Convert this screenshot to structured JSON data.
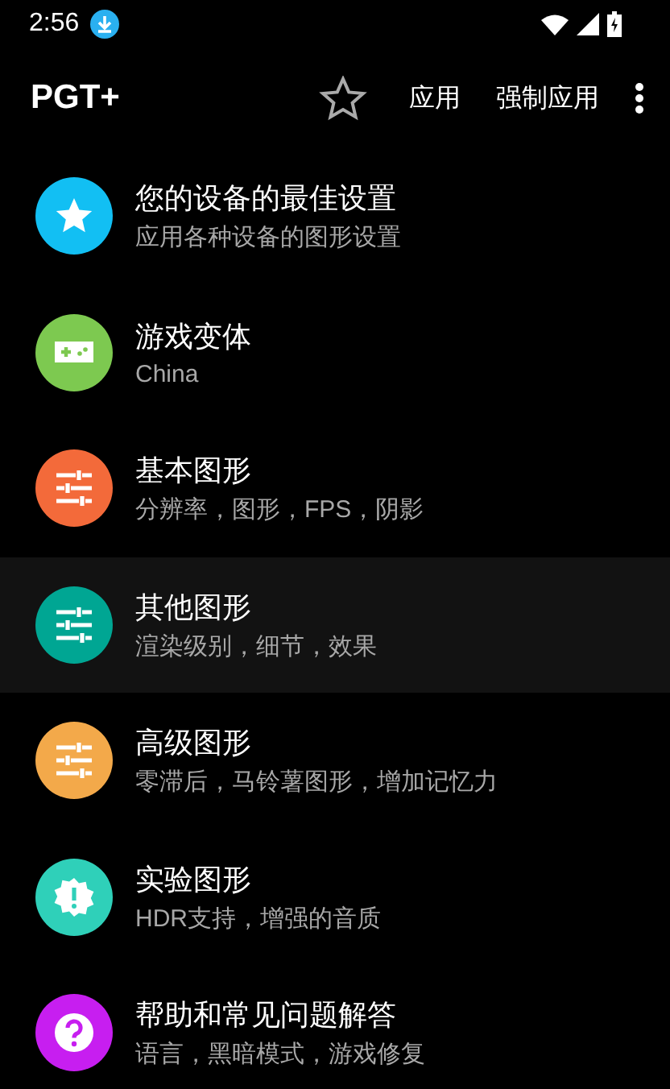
{
  "status_bar": {
    "time": "2:56"
  },
  "toolbar": {
    "title": "PGT+",
    "actions": [
      "应用",
      "强制应用"
    ]
  },
  "items": [
    {
      "title": "您的设备的最佳设置",
      "subtitle": "应用各种设备的图形设置",
      "kind": "star",
      "color": "#12bff3",
      "selected": false
    },
    {
      "title": "游戏变体",
      "subtitle": "China",
      "kind": "gamepad",
      "color": "#7dc950",
      "selected": false
    },
    {
      "title": "基本图形",
      "subtitle": "分辨率，图形，FPS，阴影",
      "kind": "sliders",
      "color": "#f36a3a",
      "selected": false
    },
    {
      "title": "其他图形",
      "subtitle": "渲染级别，细节，效果",
      "kind": "sliders",
      "color": "#00a693",
      "selected": true
    },
    {
      "title": "高级图形",
      "subtitle": "零滞后，马铃薯图形，增加记忆力",
      "kind": "sliders",
      "color": "#f3a94a",
      "selected": false
    },
    {
      "title": "实验图形",
      "subtitle": "HDR支持，增强的音质",
      "kind": "alert",
      "color": "#2fd0b9",
      "selected": false
    },
    {
      "title": "帮助和常见问题解答",
      "subtitle": "语言，黑暗模式，游戏修复",
      "kind": "question",
      "color": "#c71ef0",
      "selected": false
    }
  ]
}
